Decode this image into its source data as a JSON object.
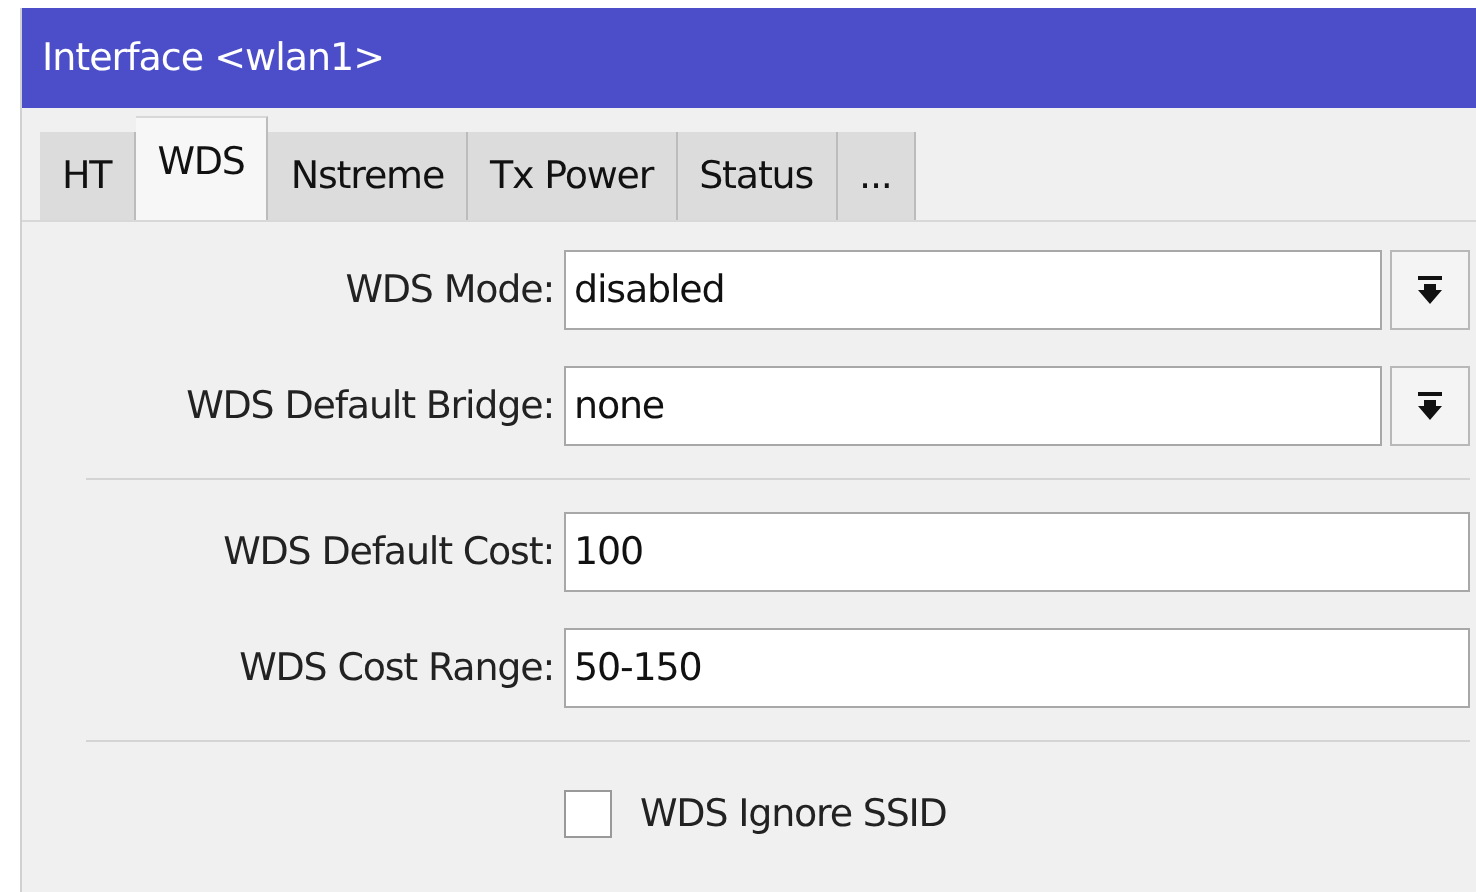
{
  "window": {
    "title": "Interface <wlan1>"
  },
  "tabs": [
    {
      "label": "HT",
      "selected": false
    },
    {
      "label": "WDS",
      "selected": true
    },
    {
      "label": "Nstreme",
      "selected": false
    },
    {
      "label": "Tx Power",
      "selected": false
    },
    {
      "label": "Status",
      "selected": false
    },
    {
      "label": "...",
      "selected": false
    }
  ],
  "groups": [
    [
      {
        "kind": "dropdown",
        "label": "WDS Mode:",
        "value": "disabled"
      },
      {
        "kind": "dropdown",
        "label": "WDS Default Bridge:",
        "value": "none"
      }
    ],
    [
      {
        "kind": "text",
        "label": "WDS Default Cost:",
        "value": "100"
      },
      {
        "kind": "text",
        "label": "WDS Cost Range:",
        "value": "50-150"
      }
    ]
  ],
  "checkboxes": [
    {
      "label": "WDS Ignore SSID",
      "checked": false
    }
  ]
}
